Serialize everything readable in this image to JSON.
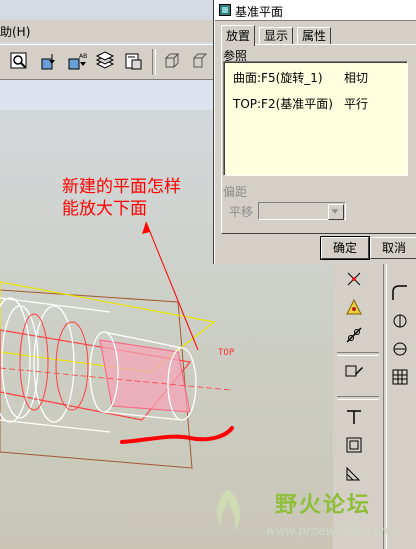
{
  "main_window": {
    "menu_fragment": "助(H)",
    "toolbar": {
      "icons": [
        "zoom-window-icon",
        "reorient-icon",
        "saved-views-icon",
        "layers-icon",
        "model-tree-icon",
        "box-view-icon",
        "box-view-2-icon"
      ]
    },
    "model_label_top": "TOP"
  },
  "dialog": {
    "title": "基准平面",
    "tabs": [
      {
        "label": "放置",
        "active": true
      },
      {
        "label": "显示",
        "active": false
      },
      {
        "label": "属性",
        "active": false
      }
    ],
    "references_label": "参照",
    "references": [
      {
        "name": "曲面:F5(旋转_1)",
        "constraint": "相切"
      },
      {
        "name": "TOP:F2(基准平面)",
        "constraint": "平行"
      }
    ],
    "offset_label": "偏距",
    "translate_label": "平移",
    "translate_value": "",
    "ok_label": "确定",
    "cancel_label": "取消"
  },
  "annotation": {
    "line1": "新建的平面怎样",
    "line2": "能放大下面"
  },
  "watermark": {
    "brand": "野火论坛",
    "url": "www.proewildfire.cn"
  },
  "colors": {
    "annotation_red": "#ff0000",
    "dialog_face": "#d4d0c8",
    "list_background": "#ffffe0",
    "plane_yellow": "#e8e400",
    "plane_brown": "#a05a30",
    "plane_red": "#ff4040",
    "surface_pink": "#f4a6b8",
    "watermark_green": "#8fbf3a"
  }
}
